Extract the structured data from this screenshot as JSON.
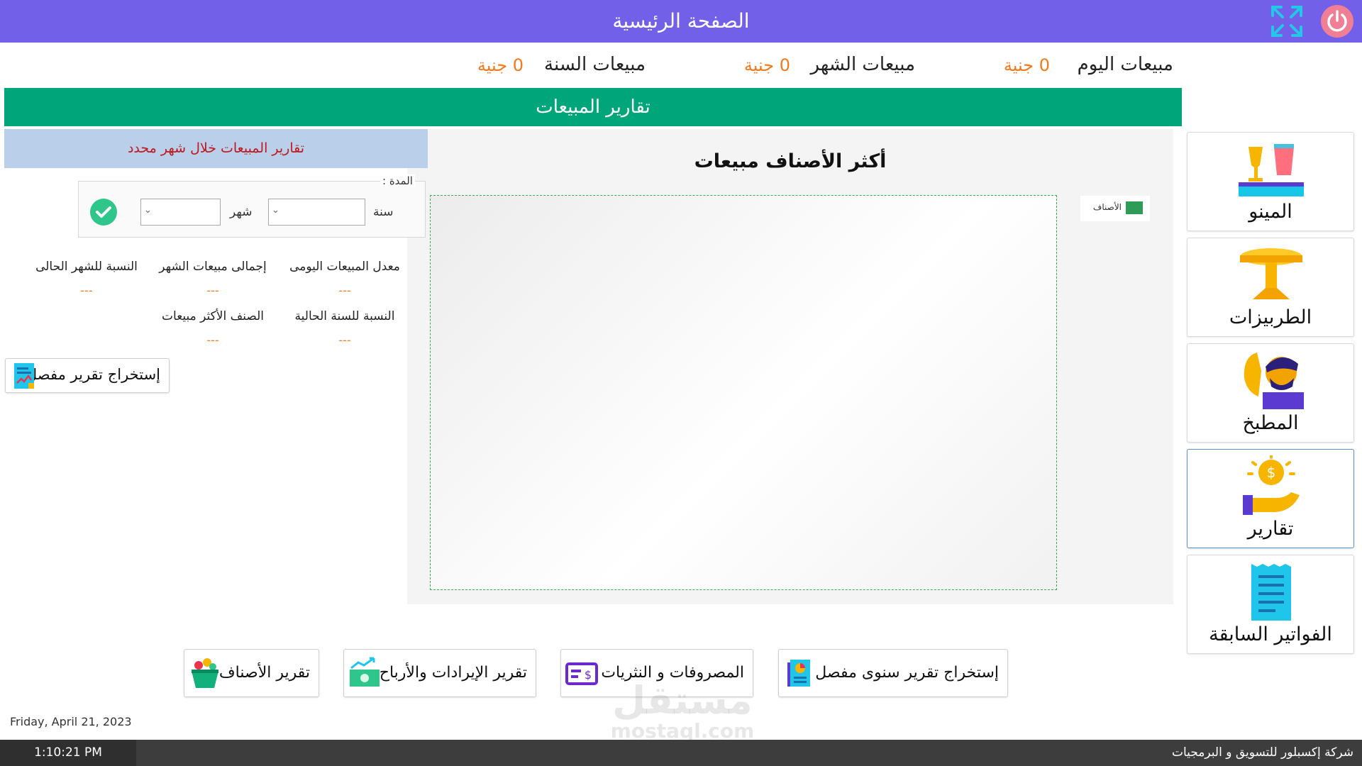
{
  "window": {
    "title": "الصفحة الرئيسية"
  },
  "stats": {
    "today_label": "مبيعات اليوم",
    "today_value": "0 جنية",
    "month_label": "مبيعات الشهر",
    "month_value": "0 جنية",
    "year_label": "مبيعات السنة",
    "year_value": "0 جنية"
  },
  "section_title": "تقارير المبيعات",
  "nav": [
    {
      "label": "المينو",
      "icon": "menu-drinks-icon"
    },
    {
      "label": "الطربيزات",
      "icon": "table-icon"
    },
    {
      "label": "المطبخ",
      "icon": "chef-icon"
    },
    {
      "label": "تقارير",
      "icon": "reports-money-icon",
      "active": true
    },
    {
      "label": "الفواتير السابقة",
      "icon": "invoice-icon"
    }
  ],
  "monthly_report": {
    "header": "تقارير المبيعات خلال شهر محدد",
    "period_label": "المدة :",
    "year_label": "سنة",
    "month_label": "شهر",
    "year_value": "",
    "month_value": "",
    "metrics": [
      {
        "label": "معدل المبيعات اليومى",
        "value": "---"
      },
      {
        "label": "إجمالى مبيعات الشهر",
        "value": "---"
      },
      {
        "label": "النسبة للشهر الحالى",
        "value": "---"
      },
      {
        "label": "النسبة للسنة الحالية",
        "value": "---"
      },
      {
        "label": "الصنف الأكثر مبيعات",
        "value": "---"
      }
    ],
    "detail_button": "إستخراج تقرير مفصل"
  },
  "chart": {
    "title": "أكثر الأصناف مبيعات",
    "legend": "الأصناف",
    "legend_color": "#2e9b57"
  },
  "bottom_buttons": [
    {
      "label": "إستخراج تقرير سنوى مفصل",
      "icon": "yearly-report-icon"
    },
    {
      "label": "المصروفات و النثريات",
      "icon": "expenses-icon"
    },
    {
      "label": "تقرير الإيرادات والأرباح",
      "icon": "revenue-profit-icon"
    },
    {
      "label": "تقرير الأصناف",
      "icon": "items-basket-icon"
    }
  ],
  "date": "Friday, April 21, 2023",
  "status": {
    "time": "1:10:21 PM",
    "company": "شركة إكسبلور للتسويق و البرمجيات"
  },
  "watermark": {
    "text": "مستقل",
    "site": "mostaql.com"
  },
  "colors": {
    "titlebar": "#7360e8",
    "section": "#00a679",
    "accent_orange": "#f17a1e",
    "monthly_header_bg": "#b9cfea",
    "monthly_header_text": "#c0161d"
  }
}
